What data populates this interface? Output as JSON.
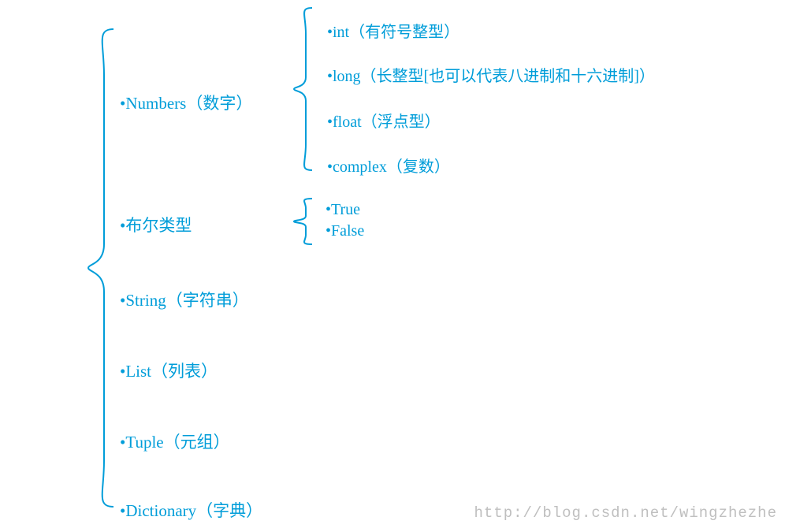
{
  "level1_items": [
    "•Numbers（数字）",
    "•布尔类型",
    "•String（字符串）",
    "•List（列表）",
    "•Tuple（元组）",
    "•Dictionary（字典）"
  ],
  "numbers_children": [
    "•int（有符号整型）",
    "•long（长整型[也可以代表八进制和十六进制]）",
    "•float（浮点型）",
    "•complex（复数）"
  ],
  "bool_children": [
    "•True",
    "•False"
  ],
  "watermark": "http://blog.csdn.net/wingzhezhe",
  "colors": {
    "accent": "#009dd9"
  }
}
